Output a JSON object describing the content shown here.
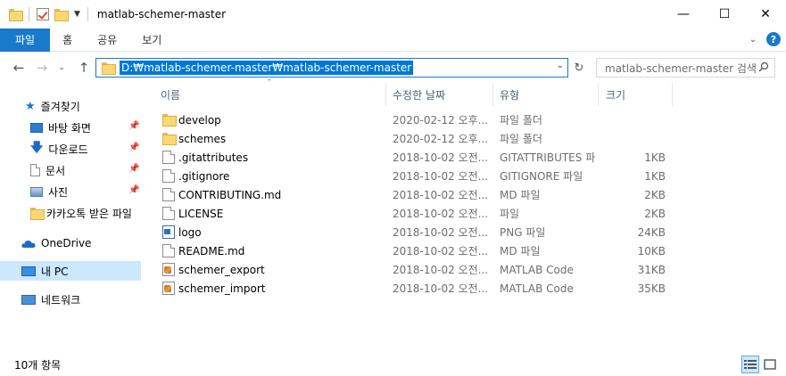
{
  "window": {
    "title": "matlab-schemer-master",
    "minimize": "—",
    "maximize": "☐",
    "close": "✕"
  },
  "ribbon": {
    "tabs": [
      "파일",
      "홈",
      "공유",
      "보기"
    ],
    "help": "?"
  },
  "address": {
    "path": "D:₩matlab-schemer-master₩matlab-schemer-master"
  },
  "search": {
    "placeholder": "matlab-schemer-master 검색"
  },
  "sidebar": {
    "quick_access": "즐겨찾기",
    "items": [
      {
        "label": "바탕 화면",
        "icon": "desktop-icon",
        "pinned": true
      },
      {
        "label": "다운로드",
        "icon": "download-icon",
        "pinned": true
      },
      {
        "label": "문서",
        "icon": "documents-icon",
        "pinned": true
      },
      {
        "label": "사진",
        "icon": "pictures-icon",
        "pinned": true
      },
      {
        "label": "카카오톡 받은 파일",
        "icon": "folder-icon",
        "pinned": false
      }
    ],
    "onedrive": "OneDrive",
    "this_pc": "내 PC",
    "network": "네트워크"
  },
  "columns": {
    "name": "이름",
    "date": "수정한 날짜",
    "type": "유형",
    "size": "크기"
  },
  "files": [
    {
      "name": "develop",
      "date": "2020-02-12 오후...",
      "type": "파일 폴더",
      "size": "",
      "icon": "folder-icon"
    },
    {
      "name": "schemes",
      "date": "2020-02-12 오후...",
      "type": "파일 폴더",
      "size": "",
      "icon": "folder-icon"
    },
    {
      "name": ".gitattributes",
      "date": "2018-10-02 오전...",
      "type": "GITATTRIBUTES 파",
      "size": "1KB",
      "icon": "file-icon"
    },
    {
      "name": ".gitignore",
      "date": "2018-10-02 오전...",
      "type": "GITIGNORE 파일",
      "size": "1KB",
      "icon": "file-icon"
    },
    {
      "name": "CONTRIBUTING.md",
      "date": "2018-10-02 오전...",
      "type": "MD 파일",
      "size": "2KB",
      "icon": "file-icon"
    },
    {
      "name": "LICENSE",
      "date": "2018-10-02 오전...",
      "type": "파일",
      "size": "2KB",
      "icon": "file-icon"
    },
    {
      "name": "logo",
      "date": "2018-10-02 오전...",
      "type": "PNG 파일",
      "size": "24KB",
      "icon": "image-icon"
    },
    {
      "name": "README.md",
      "date": "2018-10-02 오전...",
      "type": "MD 파일",
      "size": "10KB",
      "icon": "file-icon"
    },
    {
      "name": "schemer_export",
      "date": "2018-10-02 오전...",
      "type": "MATLAB Code",
      "size": "31KB",
      "icon": "matlab-icon"
    },
    {
      "name": "schemer_import",
      "date": "2018-10-02 오전...",
      "type": "MATLAB Code",
      "size": "35KB",
      "icon": "matlab-icon"
    }
  ],
  "status": {
    "count": "10개 항목"
  },
  "colors": {
    "accent": "#1979ca",
    "selection": "#cce8ff",
    "folder": "#f8d775"
  }
}
